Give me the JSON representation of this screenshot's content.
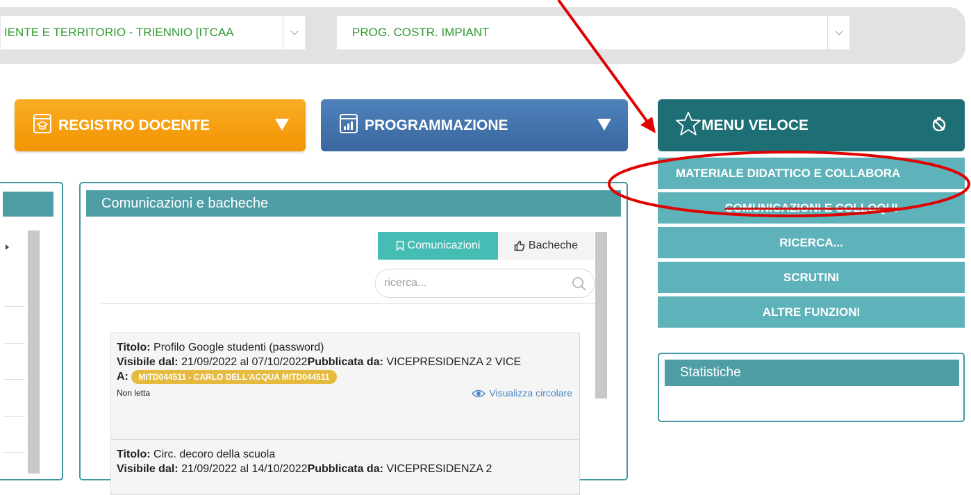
{
  "selectors": {
    "course": "IENTE E TERRITORIO - TRIENNIO [ITCAA",
    "subject": "PROG. COSTR. IMPIANT"
  },
  "buttons": {
    "registro": "REGISTRO DOCENTE",
    "programmazione": "PROGRAMMAZIONE",
    "menu_veloce": "MENU VELOCE"
  },
  "menu_veloce": {
    "items": [
      {
        "label": "MATERIALE DIDATTICO E COLLABORA"
      },
      {
        "label": "COMUNICAZIONI E COLLOQUI"
      },
      {
        "label": "RICERCA..."
      },
      {
        "label": "SCRUTINI"
      },
      {
        "label": "ALTRE FUNZIONI"
      }
    ]
  },
  "comunicazioni": {
    "title": "Comunicazioni e bacheche",
    "tab_comunicazioni": "Comunicazioni",
    "tab_bacheche": "Bacheche",
    "search_placeholder": "ricerca...",
    "labels": {
      "titolo": "Titolo:",
      "visibile": "Visibile dal:",
      "pubblicata": "Pubblicata da:",
      "a": "A:"
    },
    "cards": [
      {
        "titolo": "Profilo Google studenti (password)",
        "visibile": "21/09/2022 al 07/10/2022",
        "pubblicata": "VICEPRESIDENZA 2 VICE",
        "destinatario": "MITD044511 - CARLO DELL'ACQUA MITD044511",
        "status": "Non letta",
        "link": "Visualizza circolare"
      },
      {
        "titolo": "Circ. decoro della scuola",
        "visibile": "21/09/2022 al 14/10/2022",
        "pubblicata": "VICEPRESIDENZA 2"
      }
    ]
  },
  "statistiche": {
    "title": "Statistiche"
  },
  "colors": {
    "orange": "#f29400",
    "blue": "#3f6ea8",
    "teal_dark": "#1e6e75",
    "teal_menu": "#5eb2b9",
    "annotation_red": "#e10000",
    "badge": "#e5ba3f"
  }
}
